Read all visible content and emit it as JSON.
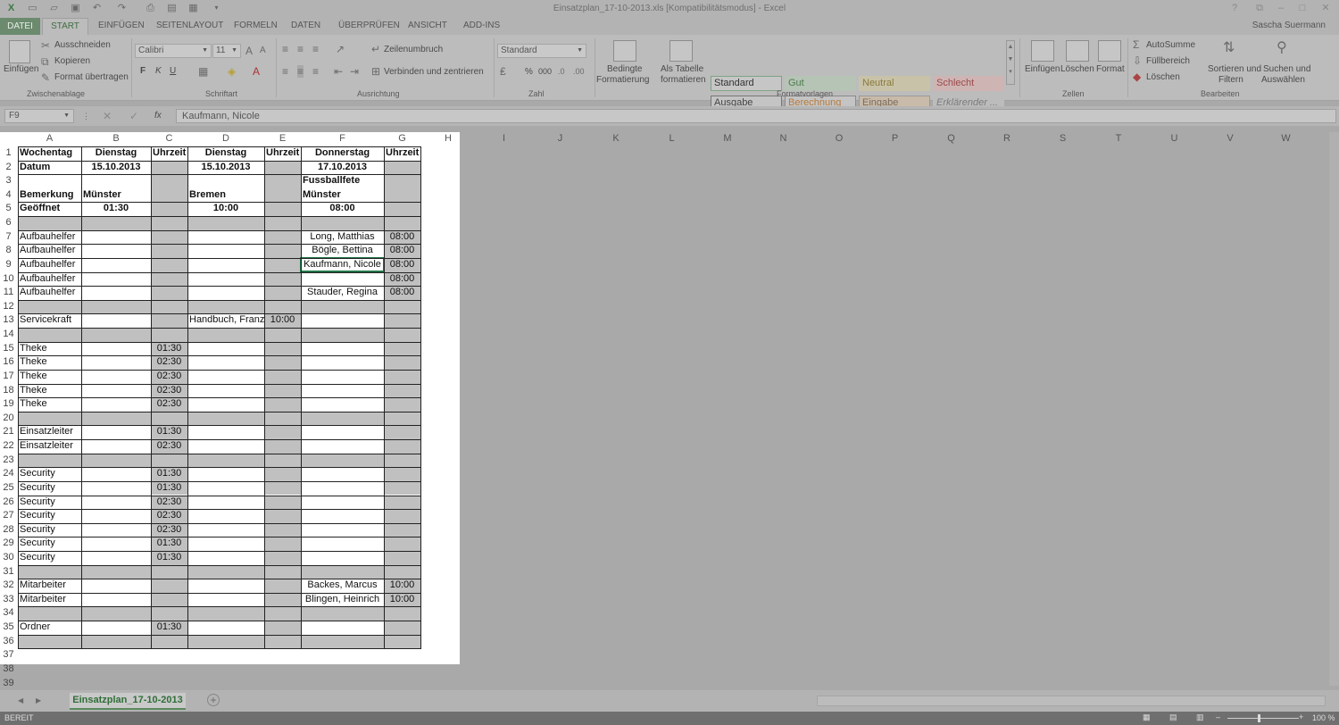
{
  "window": {
    "title": "Einsatzplan_17-10-2013.xls  [Kompatibilitätsmodus] - Excel",
    "user": "Sascha Suermann",
    "controls": [
      "?",
      "⧉",
      "–",
      "□",
      "✕"
    ]
  },
  "ribbon_tabs": [
    "DATEI",
    "START",
    "EINFÜGEN",
    "SEITENLAYOUT",
    "FORMELN",
    "DATEN",
    "ÜBERPRÜFEN",
    "ANSICHT",
    "ADD-INS"
  ],
  "ribbon": {
    "clipboard": {
      "paste": "Einfügen",
      "cut": "Ausschneiden",
      "copy": "Kopieren",
      "format_painter": "Format übertragen",
      "label": "Zwischenablage"
    },
    "font": {
      "name": "Calibri",
      "size": "11",
      "bold": "F",
      "italic": "K",
      "underline": "U",
      "label": "Schriftart"
    },
    "alignment": {
      "wrap": "Zeilenumbruch",
      "merge": "Verbinden und zentrieren",
      "label": "Ausrichtung"
    },
    "number": {
      "format": "Standard",
      "percent": "%",
      "thousands": "000",
      "label": "Zahl"
    },
    "styles": {
      "conditional": [
        "Bedingte",
        "Formatierung"
      ],
      "as_table": [
        "Als Tabelle",
        "formatieren"
      ],
      "cells": [
        {
          "text": "Standard",
          "bg": "#c6c6c6",
          "fg": "#333333",
          "border": "#7fa383"
        },
        {
          "text": "Gut",
          "bg": "#b5c4b4",
          "fg": "#4e7a4f",
          "border": "transparent"
        },
        {
          "text": "Neutral",
          "bg": "#c8c3a8",
          "fg": "#8b7a3d",
          "border": "transparent"
        },
        {
          "text": "Schlecht",
          "bg": "#cfb4b4",
          "fg": "#9b4a4a",
          "border": "transparent"
        },
        {
          "text": "Ausgabe",
          "bg": "#c4c4c4",
          "fg": "#444444",
          "border": "#777777"
        },
        {
          "text": "Berechnung",
          "bg": "#c4c4c4",
          "fg": "#b87a3a",
          "border": "#8a8a8a"
        },
        {
          "text": "Eingabe",
          "bg": "#c9bba9",
          "fg": "#7a6a5a",
          "border": "#999999"
        },
        {
          "text": "Erklärender ...",
          "bg": "#bcbcbc",
          "fg": "#7a7a7a",
          "border": "transparent"
        }
      ],
      "label": "Formatvorlagen"
    },
    "cells_grp": {
      "insert": "Einfügen",
      "delete": "Löschen",
      "format": "Format",
      "label": "Zellen"
    },
    "editing": {
      "autosum": "AutoSumme",
      "fill": "Füllbereich",
      "clear": "Löschen",
      "sort": [
        "Sortieren und",
        "Filtern"
      ],
      "find": [
        "Suchen und",
        "Auswählen"
      ],
      "label": "Bearbeiten"
    }
  },
  "formula_bar": {
    "namebox": "F9",
    "fx": "fx",
    "content": "Kaufmann, Nicole"
  },
  "columns": [
    "A",
    "B",
    "C",
    "D",
    "E",
    "F",
    "G",
    "H",
    "I",
    "J",
    "K",
    "L",
    "M",
    "N",
    "O",
    "P",
    "Q",
    "R",
    "S",
    "T",
    "U",
    "V",
    "W"
  ],
  "rows": [
    {
      "n": "1",
      "cells": [
        "Wochentag",
        "Dienstag",
        "Uhrzeit",
        "Dienstag",
        "Uhrzeit",
        "Donnerstag",
        "Uhrzeit"
      ]
    },
    {
      "n": "2",
      "cells": [
        "Datum",
        "15.10.2013",
        "",
        "15.10.2013",
        "",
        "17.10.2013",
        ""
      ]
    },
    {
      "n": "3",
      "cells": [
        "",
        "",
        "",
        "",
        "",
        "Fussballfete",
        ""
      ]
    },
    {
      "n": "4",
      "cells": [
        "Bemerkung",
        "Münster",
        "",
        "Bremen",
        "",
        "Münster",
        ""
      ]
    },
    {
      "n": "5",
      "cells": [
        "Geöffnet",
        "01:30",
        "",
        "10:00",
        "",
        "08:00",
        ""
      ]
    },
    {
      "n": "6",
      "cells": [
        "",
        "",
        "",
        "",
        "",
        "",
        ""
      ]
    },
    {
      "n": "7",
      "cells": [
        "Aufbauhelfer",
        "",
        "",
        "",
        "",
        "Long, Matthias",
        "08:00"
      ]
    },
    {
      "n": "8",
      "cells": [
        "Aufbauhelfer",
        "",
        "",
        "",
        "",
        "Bögle, Bettina",
        "08:00"
      ]
    },
    {
      "n": "9",
      "cells": [
        "Aufbauhelfer",
        "",
        "",
        "",
        "",
        "Kaufmann, Nicole",
        "08:00"
      ]
    },
    {
      "n": "10",
      "cells": [
        "Aufbauhelfer",
        "",
        "",
        "",
        "",
        "",
        "08:00"
      ]
    },
    {
      "n": "11",
      "cells": [
        "Aufbauhelfer",
        "",
        "",
        "",
        "",
        "Stauder, Regina",
        "08:00"
      ]
    },
    {
      "n": "12",
      "cells": [
        "",
        "",
        "",
        "",
        "",
        "",
        ""
      ]
    },
    {
      "n": "13",
      "cells": [
        "Servicekraft",
        "",
        "",
        "Handbuch, Franz",
        "10:00",
        "",
        ""
      ]
    },
    {
      "n": "14",
      "cells": [
        "",
        "",
        "",
        "",
        "",
        "",
        ""
      ]
    },
    {
      "n": "15",
      "cells": [
        "Theke",
        "",
        "01:30",
        "",
        "",
        "",
        ""
      ]
    },
    {
      "n": "16",
      "cells": [
        "Theke",
        "",
        "02:30",
        "",
        "",
        "",
        ""
      ]
    },
    {
      "n": "17",
      "cells": [
        "Theke",
        "",
        "02:30",
        "",
        "",
        "",
        ""
      ]
    },
    {
      "n": "18",
      "cells": [
        "Theke",
        "",
        "02:30",
        "",
        "",
        "",
        ""
      ]
    },
    {
      "n": "19",
      "cells": [
        "Theke",
        "",
        "02:30",
        "",
        "",
        "",
        ""
      ]
    },
    {
      "n": "20",
      "cells": [
        "",
        "",
        "",
        "",
        "",
        "",
        ""
      ]
    },
    {
      "n": "21",
      "cells": [
        "Einsatzleiter",
        "",
        "01:30",
        "",
        "",
        "",
        ""
      ]
    },
    {
      "n": "22",
      "cells": [
        "Einsatzleiter",
        "",
        "02:30",
        "",
        "",
        "",
        ""
      ]
    },
    {
      "n": "23",
      "cells": [
        "",
        "",
        "",
        "",
        "",
        "",
        ""
      ]
    },
    {
      "n": "24",
      "cells": [
        "Security",
        "",
        "01:30",
        "",
        "",
        "",
        ""
      ]
    },
    {
      "n": "25",
      "cells": [
        "Security",
        "",
        "01:30",
        "",
        "",
        "",
        ""
      ]
    },
    {
      "n": "26",
      "cells": [
        "Security",
        "",
        "02:30",
        "",
        "",
        "",
        ""
      ]
    },
    {
      "n": "27",
      "cells": [
        "Security",
        "",
        "02:30",
        "",
        "",
        "",
        ""
      ]
    },
    {
      "n": "28",
      "cells": [
        "Security",
        "",
        "02:30",
        "",
        "",
        "",
        ""
      ]
    },
    {
      "n": "29",
      "cells": [
        "Security",
        "",
        "01:30",
        "",
        "",
        "",
        ""
      ]
    },
    {
      "n": "30",
      "cells": [
        "Security",
        "",
        "01:30",
        "",
        "",
        "",
        ""
      ]
    },
    {
      "n": "31",
      "cells": [
        "",
        "",
        "",
        "",
        "",
        "",
        ""
      ]
    },
    {
      "n": "32",
      "cells": [
        "Mitarbeiter",
        "",
        "",
        "",
        "",
        "Backes, Marcus",
        "10:00"
      ]
    },
    {
      "n": "33",
      "cells": [
        "Mitarbeiter",
        "",
        "",
        "",
        "",
        "Blingen, Heinrich",
        "10:00"
      ]
    },
    {
      "n": "34",
      "cells": [
        "",
        "",
        "",
        "",
        "",
        "",
        ""
      ]
    },
    {
      "n": "35",
      "cells": [
        "Ordner",
        "",
        "01:30",
        "",
        "",
        "",
        ""
      ]
    },
    {
      "n": "36",
      "cells": [
        "",
        "",
        "",
        "",
        "",
        "",
        ""
      ]
    },
    {
      "n": "37",
      "cells": []
    },
    {
      "n": "38",
      "cells": []
    },
    {
      "n": "39",
      "cells": []
    }
  ],
  "sheet_tab": "Einsatzplan_17-10-2013",
  "status": {
    "mode": "BEREIT",
    "zoom": "100 %"
  }
}
